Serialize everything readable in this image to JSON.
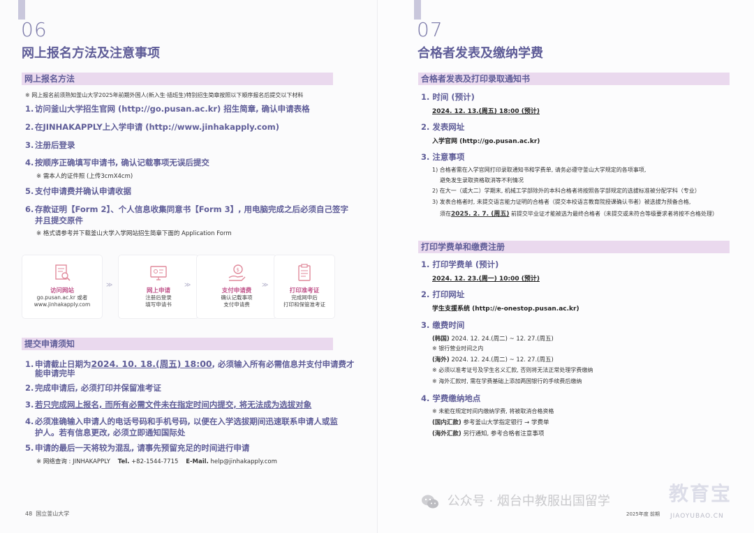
{
  "left": {
    "section_num": "06",
    "section_title": "网上报名方法及注意事项",
    "bar1": "网上报名方法",
    "note_top": "※ 网上报名前须熟知釜山大学2025年前期外国人(新入生·插班生)特别招生简章按照以下顺序报名后提交以下材料",
    "steps": [
      {
        "n": "1.",
        "text": "访问釜山大学招生官网 (http://go.pusan.ac.kr) 招生简章, 确认申请表格"
      },
      {
        "n": "2.",
        "text": "在JINHAKAPPLY上入学申请 (http://www.jinhakapply.com)"
      },
      {
        "n": "3.",
        "text": "注册后登录"
      },
      {
        "n": "4.",
        "text": "按顺序正确填写申请书, 确认记载事项无误后提交"
      },
      {
        "n": "5.",
        "text": "支付申请费并确认申请收据"
      },
      {
        "n": "6.",
        "text": "存款证明【Form 2】、个人信息收集同意书【Form 3】, 用电脑完成之后必须自己签字"
      }
    ],
    "step4_note": "※ 需本人的证件照 (上传3cmX4cm)",
    "step6_line2": "并且提交原件",
    "step6_note": "※ 格式请参考并下载釜山大学入学网站招生简章下面的 Application Form",
    "cards": [
      {
        "title": "访问网站",
        "sub1": "go.pusan.ac.kr 或者",
        "sub2": "www.jinhakapply.com"
      },
      {
        "title": "网上申请",
        "sub1": "注册后登录",
        "sub2": "填写申请书"
      },
      {
        "title": "支付申请费",
        "sub1": "确认记载事项",
        "sub2": "支付申请费"
      },
      {
        "title": "打印准考证",
        "sub1": "完成网申后",
        "sub2": "打印和保管准考证"
      }
    ],
    "arrow": "≫",
    "bar2": "提交申请须知",
    "notices": [
      {
        "n": "1.",
        "pre": "申请截止日期为",
        "hl": "2024. 10. 18.(周五) 18:00",
        "post": ", 必须输入所有必需信息并支付申请费才"
      },
      {
        "n": "2.",
        "text": "完成申请后, 必须打印并保留准考证"
      },
      {
        "n": "3.",
        "text": "若只完成网上报名, 而所有必需文件未在指定时间内提交, 将无法成为选拔对象"
      },
      {
        "n": "4.",
        "text": "必须准确输入申请人的电话号码和手机号码, 以便在入学选拔期间迅速联系申请人或监"
      },
      {
        "n": "5.",
        "text": "申请的最后一天将较为混乱, 请事先预留充足的时间进行申请"
      }
    ],
    "notice1_line2": "能申请完毕",
    "notice4_line2": "护人。若有信息更改, 必须立即通知国际处",
    "contact_pre": "※ 网络查询 : JINHAKAPPLY",
    "contact_tel_label": "Tel.",
    "contact_tel": "+82-1544-7715",
    "contact_mail_label": "E-Mail.",
    "contact_mail": "help@jinhakapply.com",
    "footer_page": "48",
    "footer_school": "国立釜山大学"
  },
  "right": {
    "section_num": "07",
    "section_title": "合格者发表及缴纳学费",
    "bar1": "合格者发表及打印录取通知书",
    "r1_title": "1. 时间 (预计)",
    "r1_value": "2024. 12. 13.(周五) 18:00 (预计)",
    "r2_title": "2. 发表网址",
    "r2_value": "入学官网 (http://go.pusan.ac.kr)",
    "r3_title": "3. 注意事项",
    "r3_lines": [
      "1) 合格者需在入学官网打印录取通知书和学费单, 请务必遵守釜山大学规定的各项事项,",
      "避免发生录取资格取消等不利情况",
      "2) 在大一（或大二）学期末, 机械工学部除外的本科合格者将按照各学部规定的选拔标准被分配学科（专业）",
      "3) 发表合格者时, 未提交语言能力证明的合格者（提交本校语言教育院授课确认书者）被选拔为预备合格,",
      "须在",
      "2025. 2. 7. (周五)",
      "前提交毕业证才能被选为最终合格者（未提交或未符合等级要求者将按不合格处理）"
    ],
    "bar2": "打印学费单和缴费注册",
    "p1_title": "1. 打印学费单 (预计)",
    "p1_value": "2024. 12. 23.(周一) 10:00 (预计)",
    "p2_title": "2. 打印网址",
    "p2_value": "学生支援系统 (http://e-onestop.pusan.ac.kr)",
    "p3_title": "3. 缴费时间",
    "p3_korea_label": "(韩国)",
    "p3_korea": "2024. 12. 24.(周二) ~ 12. 27.(周五)",
    "p3_korea_note": "※ 银行营业时间之内",
    "p3_abroad_label": "(海外)",
    "p3_abroad": "2024. 12. 24.(周二) ~ 12. 27.(周五)",
    "p3_note1": "※ 必须以准考证号及学生名义汇款, 否则将无法正常处理学费缴纳",
    "p3_note2": "※ 海外汇款时, 需在学费基础上添加两国银行的手续费后缴纳",
    "p4_title": "4. 学费缴纳地点",
    "p4_note": "※ 未能在规定时间内缴纳学费, 将被取消合格资格",
    "p4_korea_label": "(国内汇款)",
    "p4_korea": "参考釜山大学指定银行 → 学费单",
    "p4_abroad_label": "(海外汇款)",
    "p4_abroad": "另行通知, 参考合格者注意事项",
    "footer_year": "2025年度 前期"
  },
  "watermark": {
    "text": "公众号 · 烟台中教服出国留学",
    "brand": "教育宝",
    "url": "JIAOYUBAO.CN"
  },
  "colors": {
    "accent": "#5f5d98",
    "bar_bg": "#ead9ee",
    "card_title": "#c0548a",
    "tab": "#c9c7dc"
  }
}
